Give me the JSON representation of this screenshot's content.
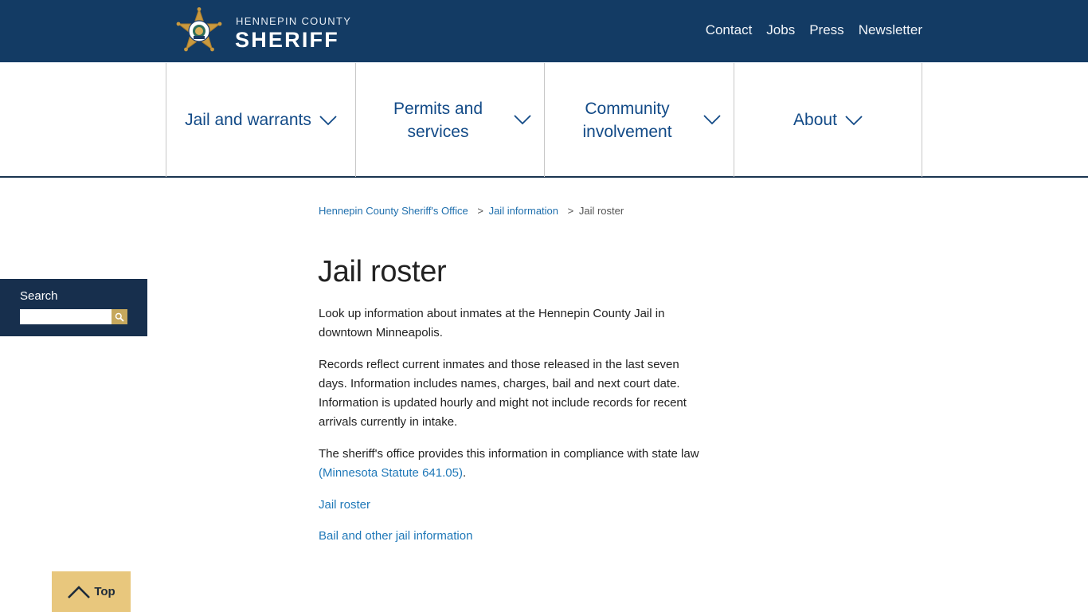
{
  "header": {
    "logo_county": "HENNEPIN COUNTY",
    "logo_title": "SHERIFF",
    "utility_links": [
      "Contact",
      "Jobs",
      "Press",
      "Newsletter"
    ]
  },
  "main_nav": {
    "items": [
      {
        "label": "Jail and warrants"
      },
      {
        "label_line1": "Permits and",
        "label_line2": "services"
      },
      {
        "label_line1": "Community",
        "label_line2": "involvement"
      },
      {
        "label": "About"
      }
    ]
  },
  "breadcrumb": {
    "items": [
      "Hennepin County Sheriff's Office",
      "Jail information",
      "Jail roster"
    ],
    "separator": ">"
  },
  "page": {
    "title": "Jail roster",
    "paragraph1": "Look up information about inmates at the Hennepin County Jail in downtown Minneapolis.",
    "paragraph2": "Records reflect current inmates and those released in the last seven days. Information includes names, charges, bail and next court date. Information is updated hourly and might not include records for recent arrivals currently in intake.",
    "paragraph3_text": "The sheriff's office provides this information in compliance with state law ",
    "paragraph3_link": "(Minnesota Statute 641.05)",
    "paragraph3_end": ".",
    "link1": "Jail roster",
    "link2": "Bail and other jail information"
  },
  "search": {
    "label": "Search",
    "value": "",
    "placeholder": "",
    "button_icon": "search-icon"
  },
  "back_to_top": {
    "label": "Top",
    "icon": "chevron-up-icon"
  },
  "colors": {
    "header_bg": "#133b64",
    "nav_text": "#124a87",
    "link": "#1f78b8",
    "search_panel_bg": "#172f4d",
    "search_button": "#c6a85d",
    "top_button": "#e8c77d",
    "logo_gold": "#c9993f"
  }
}
